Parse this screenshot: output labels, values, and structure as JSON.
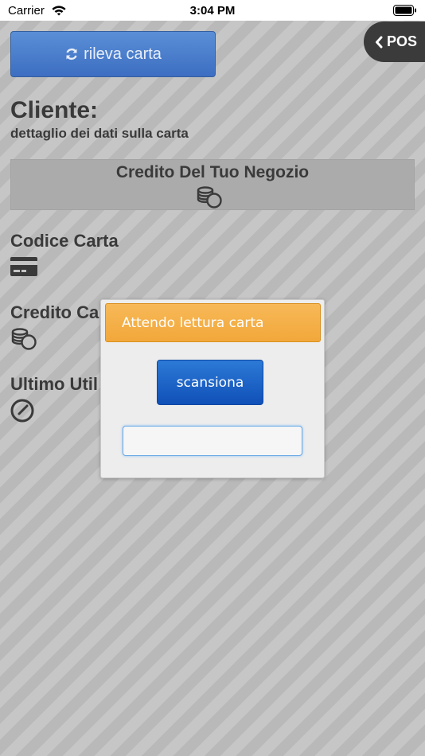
{
  "status_bar": {
    "carrier": "Carrier",
    "time": "3:04 PM"
  },
  "header": {
    "pos_label": "POS",
    "rileva_label": "rileva carta"
  },
  "cliente": {
    "title": "Cliente:",
    "subtitle": "dettaglio dei dati sulla carta"
  },
  "credit_box": {
    "label": "Credito Del Tuo Negozio"
  },
  "fields": {
    "codice_label": "Codice Carta",
    "credito_label": "Credito Ca",
    "ultimo_label": "Ultimo Util"
  },
  "dialog": {
    "title": "Attendo lettura carta",
    "scan_label": "scansiona",
    "input_value": "",
    "input_placeholder": ""
  },
  "icons": {
    "wifi": "wifi-icon",
    "battery": "battery-icon",
    "back": "chevron-left-icon",
    "refresh": "refresh-icon",
    "coins": "coins-icon",
    "card": "credit-card-icon",
    "clock": "clock-icon"
  },
  "colors": {
    "rileva_button": "#4a7fcd",
    "dialog_header": "#f4ad45",
    "scan_button": "#1a5fc6",
    "pos_button": "#3b3b3b"
  }
}
